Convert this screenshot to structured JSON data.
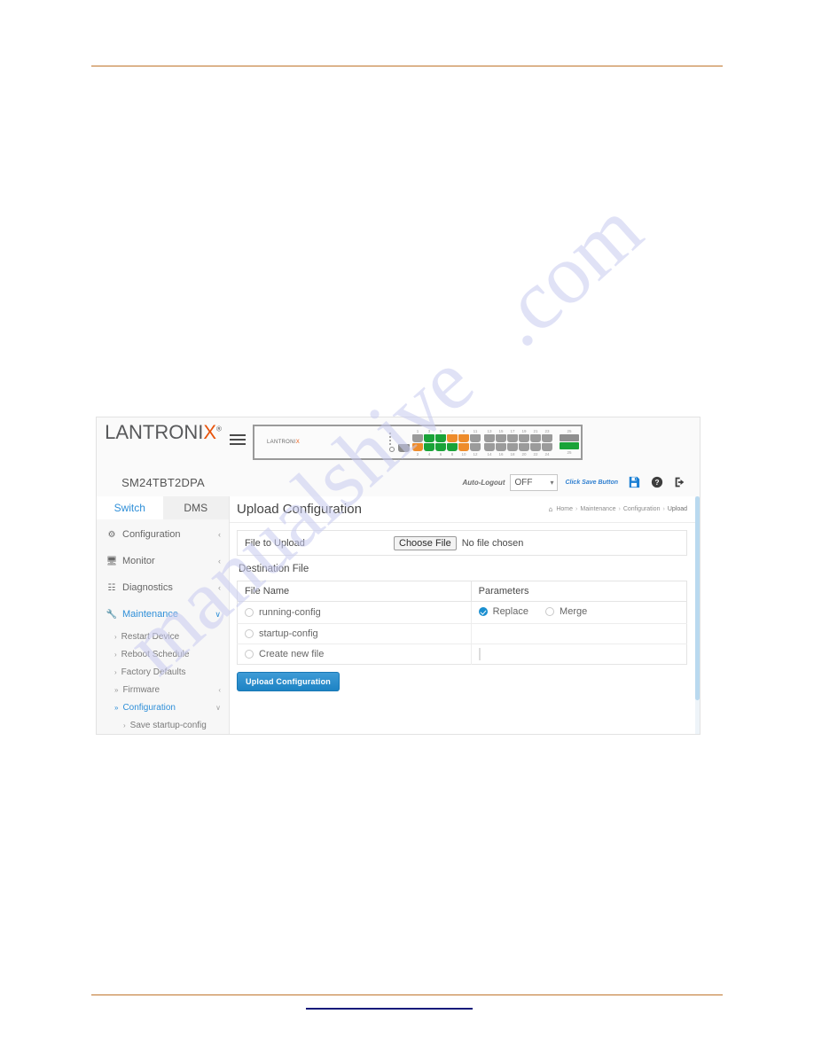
{
  "document": {
    "watermark_left": "manualshive",
    "watermark_right": ".com"
  },
  "brand": {
    "logo_main": "LANTRONI",
    "logo_x": "X",
    "logo_reg": "®",
    "model": "SM24TBT2DPA",
    "device_logo_main": "LANTRONI",
    "device_logo_x": "X"
  },
  "device": {
    "top_port_numbers": [
      "1",
      "3",
      "5",
      "7",
      "9",
      "11",
      "13",
      "15",
      "17",
      "19",
      "21",
      "23",
      "25",
      "26"
    ],
    "bottom_port_numbers": [
      "2",
      "4",
      "6",
      "8",
      "10",
      "12",
      "14",
      "16",
      "18",
      "20",
      "22",
      "24",
      "25",
      "26"
    ]
  },
  "toolbar": {
    "auto_logout_label": "Auto-Logout",
    "auto_logout_value": "OFF",
    "auto_logout_options": [
      "OFF"
    ],
    "click_save_text": "Click Save Button",
    "save_icon": "floppy-disk-icon",
    "help_icon": "question-circle-icon",
    "logout_icon": "sign-out-icon"
  },
  "sidebar": {
    "tabs": [
      {
        "label": "Switch",
        "active": true
      },
      {
        "label": "DMS",
        "active": false
      }
    ],
    "items": [
      {
        "label": "Configuration",
        "icon": "gear-icon",
        "arrow": "‹",
        "active": false
      },
      {
        "label": "Monitor",
        "icon": "monitor-icon",
        "arrow": "‹",
        "active": false
      },
      {
        "label": "Diagnostics",
        "icon": "sitemap-icon",
        "arrow": "‹",
        "active": false
      },
      {
        "label": "Maintenance",
        "icon": "wrench-icon",
        "arrow": "∨",
        "active": true
      }
    ],
    "submenu": [
      {
        "label": "Restart Device",
        "caret": "›",
        "selected": false,
        "arrow": ""
      },
      {
        "label": "Reboot Schedule",
        "caret": "›",
        "selected": false,
        "arrow": ""
      },
      {
        "label": "Factory Defaults",
        "caret": "›",
        "selected": false,
        "arrow": ""
      },
      {
        "label": "Firmware",
        "caret": "»",
        "selected": false,
        "arrow": "‹"
      },
      {
        "label": "Configuration",
        "caret": "»",
        "selected": true,
        "arrow": "∨"
      }
    ],
    "submenu_level2": [
      {
        "label": "Save startup-config",
        "caret": "›"
      }
    ]
  },
  "main": {
    "page_title": "Upload Configuration",
    "breadcrumb": {
      "home": "Home",
      "home_icon": "home-icon",
      "items": [
        "Maintenance",
        "Configuration",
        "Upload"
      ],
      "separator": "›"
    },
    "file_to_upload": {
      "label": "File to Upload",
      "button_label": "Choose File",
      "status": "No file chosen"
    },
    "destination_file": {
      "title": "Destination File",
      "columns": [
        "File Name",
        "Parameters"
      ],
      "rows": [
        {
          "name": "running-config",
          "checked": false,
          "params": [
            {
              "label": "Replace",
              "checked": true
            },
            {
              "label": "Merge",
              "checked": false
            }
          ],
          "input": null
        },
        {
          "name": "startup-config",
          "checked": false,
          "params": [],
          "input": null
        },
        {
          "name": "Create new file",
          "checked": false,
          "params": [],
          "input": ""
        }
      ]
    },
    "submit_label": "Upload Configuration"
  },
  "colors": {
    "accent": "#2f8fd8",
    "brand_orange": "#e8540c",
    "rule": "#c0752c",
    "link": "#121a7a",
    "port_green": "#1aa338",
    "port_orange": "#ee8c2b",
    "port_gray": "#9b9b9b"
  }
}
